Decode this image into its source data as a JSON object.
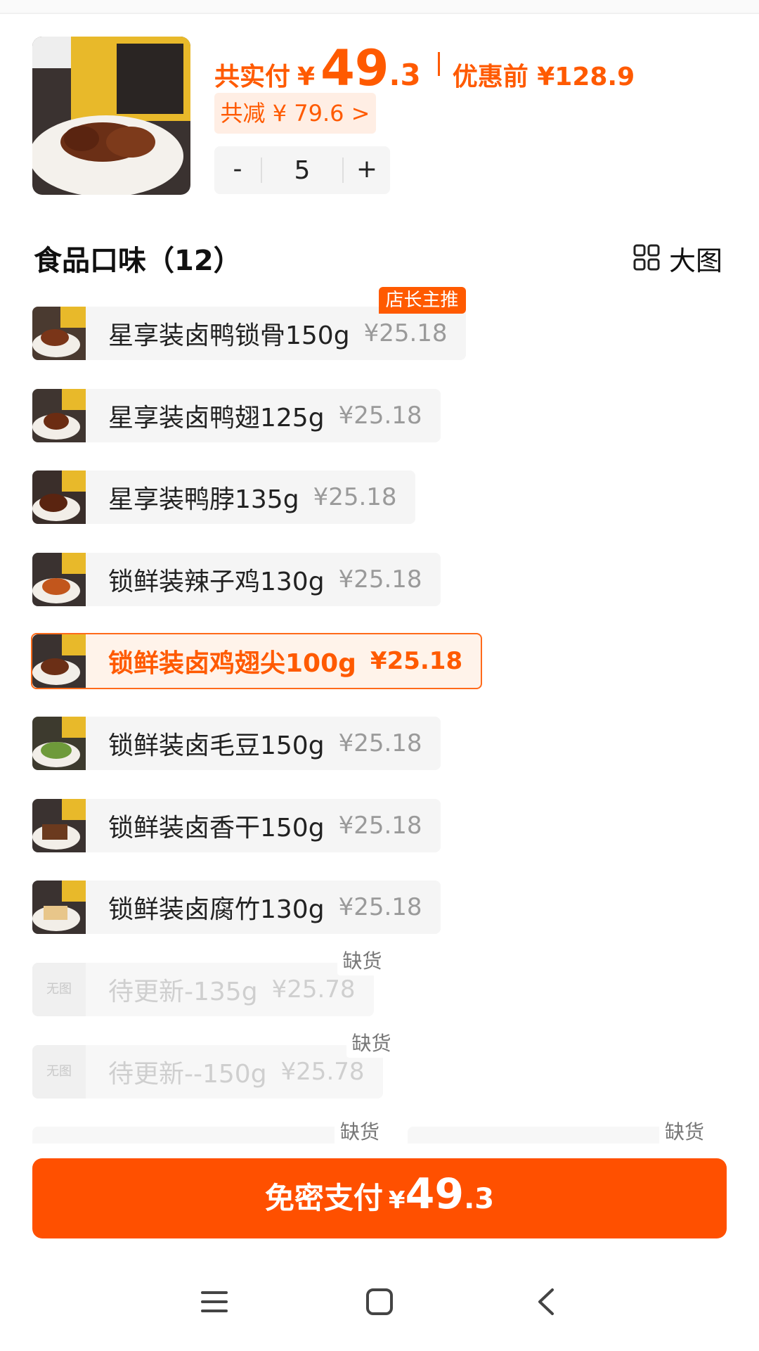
{
  "header": {
    "total_label": "共实付",
    "currency": "¥",
    "total_int": "49",
    "total_dec": ".3",
    "orig_label": "优惠前 ¥128.9",
    "discount": "共减 ¥ 79.6 >",
    "quantity": "5",
    "minus": "-",
    "plus": "+"
  },
  "section": {
    "title": "食品口味（12）",
    "bigview_label": "大图"
  },
  "options": [
    {
      "name": "星享装卤鸭锁骨150g",
      "price": "¥25.18",
      "badge": "店长主推"
    },
    {
      "name": "星享装卤鸭翅125g",
      "price": "¥25.18"
    },
    {
      "name": "星享装鸭脖135g",
      "price": "¥25.18"
    },
    {
      "name": "锁鲜装辣子鸡130g",
      "price": "¥25.18"
    },
    {
      "name": "锁鲜装卤鸡翅尖100g",
      "price": "¥25.18",
      "selected": true
    },
    {
      "name": "锁鲜装卤毛豆150g",
      "price": "¥25.18"
    },
    {
      "name": "锁鲜装卤香干150g",
      "price": "¥25.18"
    },
    {
      "name": "锁鲜装卤腐竹130g",
      "price": "¥25.18"
    },
    {
      "name": "待更新-135g",
      "price": "¥25.78",
      "noimg": "无图",
      "badge": "缺货"
    },
    {
      "name": "待更新--150g",
      "price": "¥25.78",
      "noimg": "无图",
      "badge": "缺货"
    }
  ],
  "partial_badges": [
    "缺货",
    "缺货"
  ],
  "pay": {
    "label": "免密支付",
    "currency": "¥",
    "int": "49",
    "dec": ".3"
  },
  "colors": {
    "accent": "#ff5a00",
    "button": "#ff5000",
    "tag_bg": "#ffeee4",
    "option_bg": "#f5f5f5"
  },
  "icons": [
    "grid-icon",
    "menu-icon",
    "home-icon",
    "back-icon"
  ]
}
